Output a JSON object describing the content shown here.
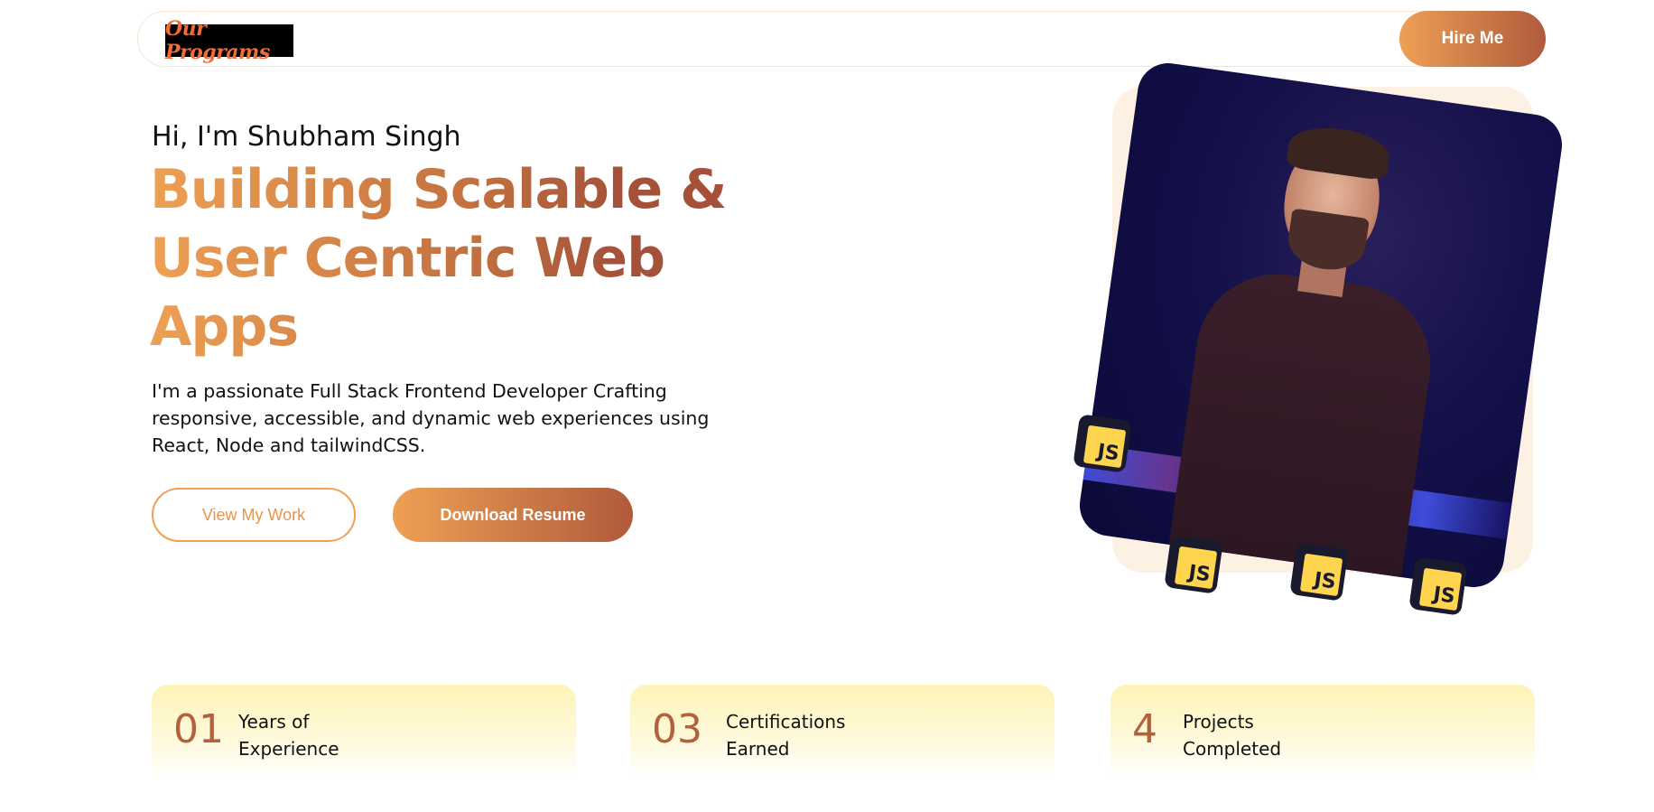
{
  "nav": {
    "logo_text": "Our Programs",
    "hire_label": "Hire Me"
  },
  "hero": {
    "greeting": "Hi, I'm Shubham Singh",
    "headline_lines": [
      "Building Scalable &",
      "User Centric Web",
      "Apps"
    ],
    "intro": "I'm a passionate Full Stack Frontend Developer Crafting responsive, accessible, and dynamic web experiences using React, Node and tailwindCSS.",
    "view_work_label": "View My Work",
    "download_label": "Download Resume"
  },
  "badges": [
    {
      "text": "JS"
    },
    {
      "text": "JS"
    },
    {
      "text": "JS"
    },
    {
      "text": "JS"
    }
  ],
  "stats": [
    {
      "number": "01",
      "label_line1": "Years of",
      "label_line2": "Experience"
    },
    {
      "number": "03",
      "label_line1": "Certifications",
      "label_line2": "Earned"
    },
    {
      "number": "4",
      "label_line1": "Projects",
      "label_line2": "Completed"
    }
  ],
  "colors": {
    "accent_start": "#eea054",
    "accent_end": "#b05a3c",
    "stat_number": "#b3603d",
    "card_bg": "#fdf3b8",
    "js_yellow": "#ffd44f"
  }
}
